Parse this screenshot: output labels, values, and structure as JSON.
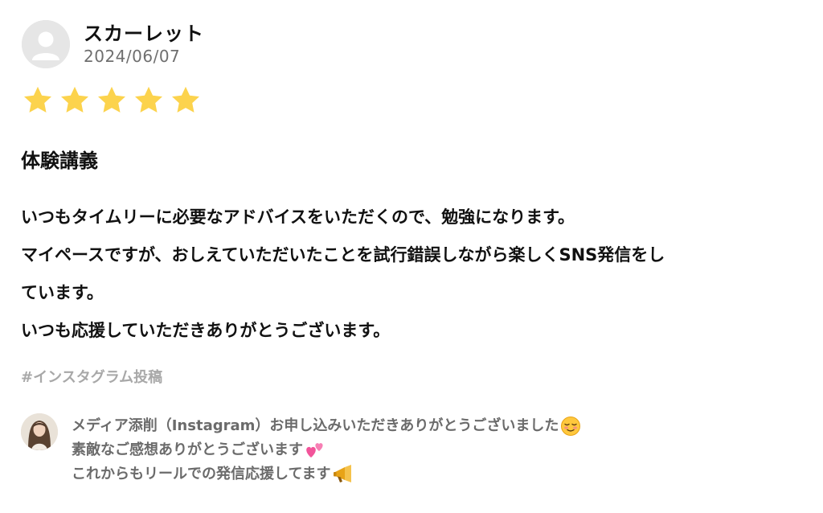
{
  "review": {
    "author": "スカーレット",
    "date": "2024/06/07",
    "rating": 5,
    "star_color": "#FCD34D",
    "title": "体験講義",
    "body_lines": [
      "いつもタイムリーに必要なアドバイスをいただくので、勉強になります。",
      "マイペースですが、おしえていただいたことを試行錯誤しながら楽しくSNS発信をし",
      "ています。",
      "いつも応援していただきありがとうございます。"
    ],
    "tag": "#インスタグラム投稿"
  },
  "reply": {
    "lines": [
      "メディア添削（Instagram）お申し込みいただきありがとうございました",
      "素敵なご感想ありがとうございます",
      "これからもリールでの発信応援してます"
    ],
    "emojis": [
      "relieved-smile-icon",
      "two-hearts-icon",
      "megaphone-icon"
    ]
  }
}
